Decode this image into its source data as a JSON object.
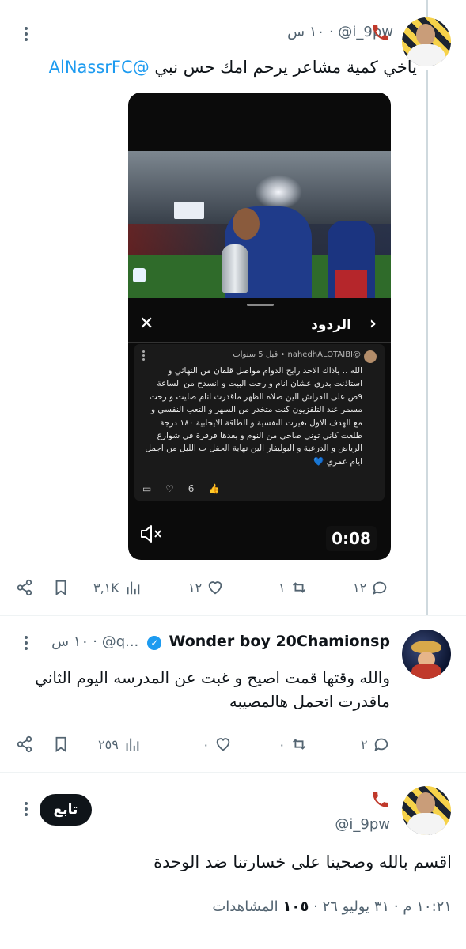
{
  "tweet1": {
    "handle": "@i_9pw",
    "time": "١٠ س",
    "text": "ياخي كمية مشاعر يرحم امك حس نبي",
    "mention": "@AlNassrFC",
    "media": {
      "replies_header": "الردود",
      "reply_user": "@nahedhALOTAIBI",
      "reply_time": "قبل 5 سنوات",
      "reply_text": "الله .. ياذاك الاحد رايح الدوام مواصل قلقان من النهائي و استاذنت بدري عشان انام و رحت البيت و انسدح من الساعة ٩ص على الفراش الين صلاة الظهر ماقدرت انام صليت و رحت مسمر عند التلفزيون كنت متخدر من السهر و التعب النفسي و مع الهدف الاول تغيرت النفسية و الطاقة الايجابية ١٨٠ درجة طلعت كاني توني صاحي من النوم و بعدها فرفرة في شوارع الرياض و الدرعية و البوليفار الين نهاية الحفل ب الليل من اجمل ايام عمري 💙",
      "reply_likes": "6",
      "duration": "0:08"
    },
    "stats": {
      "replies": "١٢",
      "retweets": "١",
      "likes": "١٢",
      "views": "٣,١K"
    }
  },
  "tweet2": {
    "name": "Wonder boy 20Chamionsp",
    "handle": "@q...",
    "time": "١٠ س",
    "text_line1": "والله وقتها قمت اصيح و غبت عن المدرسه اليوم الثاني",
    "text_line2": "ماقدرت اتحمل هالمصيبه",
    "stats": {
      "replies": "٢",
      "retweets": "٠",
      "likes": "٠",
      "views": "٢٥٩"
    }
  },
  "tweet3": {
    "handle": "@i_9pw",
    "follow_label": "تابع",
    "text": "اقسم بالله وصحينا على خسارتنا ضد الوحدة",
    "time": "١٠:٢١ م",
    "date": "٣١ يوليو ٢٦",
    "views_count": "١٠٥",
    "views_label": "المشاهدات"
  },
  "colors": {
    "accent": "#1d9bf0",
    "text": "#0f1419",
    "muted": "#536471"
  }
}
